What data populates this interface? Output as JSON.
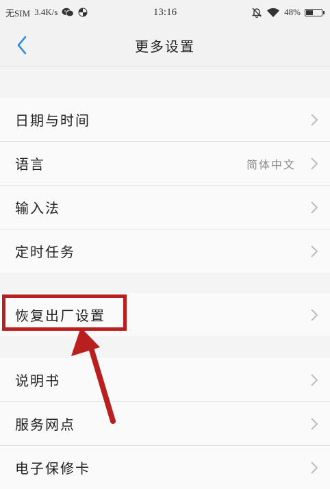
{
  "status_bar": {
    "sim": "无SIM",
    "speed": "3.4K/s",
    "time": "13:16",
    "battery": "48%",
    "battery_level": 0.48,
    "icons": [
      "wechat-icon",
      "pinwheel-icon",
      "bell-off-icon",
      "wifi-icon",
      "battery-icon"
    ]
  },
  "header": {
    "title": "更多设置",
    "back_icon": "chevron-left-icon"
  },
  "groups": [
    {
      "items": [
        {
          "label": "日期与时间"
        },
        {
          "label": "语言",
          "value": "简体中文"
        },
        {
          "label": "输入法"
        },
        {
          "label": "定时任务"
        }
      ]
    },
    {
      "items": [
        {
          "label": "恢复出厂设置",
          "highlighted": true
        }
      ]
    },
    {
      "items": [
        {
          "label": "说明书"
        },
        {
          "label": "服务网点"
        },
        {
          "label": "电子保修卡"
        }
      ]
    }
  ],
  "colors": {
    "accent": "#2b8fe8",
    "annotation": "#b81f1f",
    "background": "#f4f4f4",
    "row_bg": "#fafafa"
  }
}
